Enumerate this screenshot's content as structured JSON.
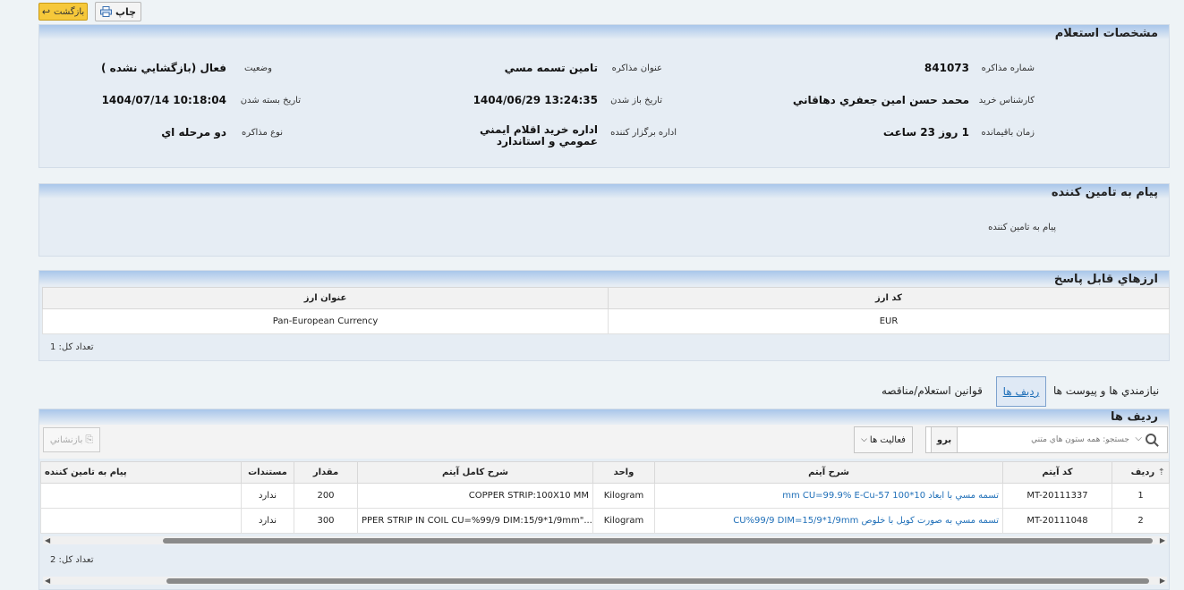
{
  "toolbar": {
    "back_label": "بازگشت",
    "print_label": "چاپ"
  },
  "specs": {
    "title": "مشخصات استعلام",
    "fields": {
      "number_label": "شماره مذاکره",
      "number_value": "841073",
      "subject_label": "عنوان مذاکره",
      "subject_value": "تامين تسمه مسي",
      "status_label": "وضعيت",
      "status_value": "فعال (بازگشايي نشده )",
      "expert_label": "کارشناس خريد",
      "expert_value": "محمد حسن امين جعفري دهاقاني",
      "open_date_label": "تاريخ باز شدن",
      "open_date_value": "1404/06/29 13:24:35",
      "close_date_label": "تاريخ بسته شدن",
      "close_date_value": "1404/07/14 10:18:04",
      "remaining_label": "زمان باقيمانده",
      "remaining_value": "1 روز 23 ساعت",
      "dept_label": "اداره برگزار کننده",
      "dept_value": "اداره خريد اقلام ايمني عمومي و استاندارد",
      "type_label": "نوع مذاکره",
      "type_value": "دو مرحله اي"
    }
  },
  "supplier_message": {
    "title": "پيام به تامين کننده",
    "label": "پيام به تامين کننده"
  },
  "currencies": {
    "title": "ارزهاي قابل پاسخ",
    "headers": {
      "code": "کد ارز",
      "name": "عنوان ارز"
    },
    "rows": [
      {
        "code": "EUR",
        "name": "Pan-European Currency"
      }
    ],
    "count": "تعداد کل: 1"
  },
  "tabs": {
    "rows": "رديف ها",
    "rules": "قوانين استعلام/مناقصه",
    "needs": "نيازمندي ها و پيوست ها"
  },
  "items": {
    "title": "رديف ها",
    "search_placeholder": "جستجو: همه ستون هاي متني",
    "go_label": "برو",
    "actions_label": "فعاليت ها",
    "reset_label": "بازنشاني",
    "headers": {
      "row": "رديف",
      "code": "کد آيتم",
      "desc": "شرح آيتم",
      "unit": "واحد",
      "full_desc": "شرح کامل آيتم",
      "qty": "مقدار",
      "docs": "مستندات",
      "message": "پيام به تامين کننده"
    },
    "rows": [
      {
        "row": "1",
        "code": "MT-20111337",
        "desc": "تسمه مسي با ابعاد 10*100 mm CU=99.9% E-Cu-57",
        "unit": "Kilogram",
        "full_desc": "COPPER STRIP:100X10 MM",
        "qty": "200",
        "docs": "ندارد",
        "message": ""
      },
      {
        "row": "2",
        "code": "MT-20111048",
        "desc": "تسمه مسي به صورت کويل با خلوص CU%99/9 DIM=15/9*1/9mm",
        "unit": "Kilogram",
        "full_desc": "PPER STRIP IN COIL CU=%99/9 DIM:15/9*1/9mm\"...",
        "qty": "300",
        "docs": "ندارد",
        "message": ""
      }
    ],
    "count": "تعداد کل: 2"
  }
}
